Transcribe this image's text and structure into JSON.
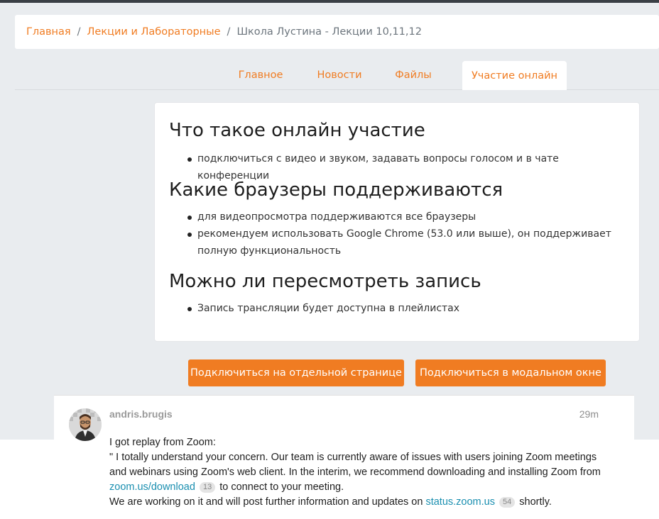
{
  "breadcrumb": {
    "items": [
      "Главная",
      "Лекции и Лабораторные"
    ],
    "current": "Школа Лустина - Лекции 10,11,12",
    "separator": "/"
  },
  "tabs": [
    {
      "label": "Главное",
      "active": false
    },
    {
      "label": "Новости",
      "active": false
    },
    {
      "label": "Файлы",
      "active": false
    },
    {
      "label": "Участие онлайн",
      "active": true
    }
  ],
  "content": {
    "sections": [
      {
        "heading": "Что такое онлайн участие",
        "bullets": [
          "подключиться с видео и звуком, задавать вопросы голосом и в чате конференции"
        ]
      },
      {
        "heading": "Какие браузеры поддерживаются",
        "bullets": [
          "для видеопросмотра поддерживаются все браузеры",
          "рекомендуем использовать Google Chrome (53.0 или выше), он поддерживает полную функциональность"
        ]
      },
      {
        "heading": "Можно ли пересмотреть запись",
        "bullets": [
          "Запись трансляции будет доступна в плейлистах"
        ]
      }
    ]
  },
  "buttons": {
    "separate_page": "Подключиться на отдельной странице",
    "modal": "Подключиться в модальном окне"
  },
  "comment": {
    "username": "andris.brugis",
    "time": "29m",
    "line1": "I got replay from Zoom:",
    "para_start": "\" I totally understand your concern. Our team is currently aware of issues with users joining Zoom meetings and webinars using Zoom's web client. In the interim, we recommend downloading and installing Zoom from ",
    "link1": "zoom.us/download",
    "link1_count": "13",
    "para_mid": " to connect to your meeting.",
    "line3_start": "We are working on it and will post further information and updates on ",
    "link2": "status.zoom.us",
    "link2_count": "54",
    "line3_end": " shortly."
  },
  "colors": {
    "accent": "#f07c22",
    "background": "#e9ecef",
    "link": "#1a8fb0"
  }
}
